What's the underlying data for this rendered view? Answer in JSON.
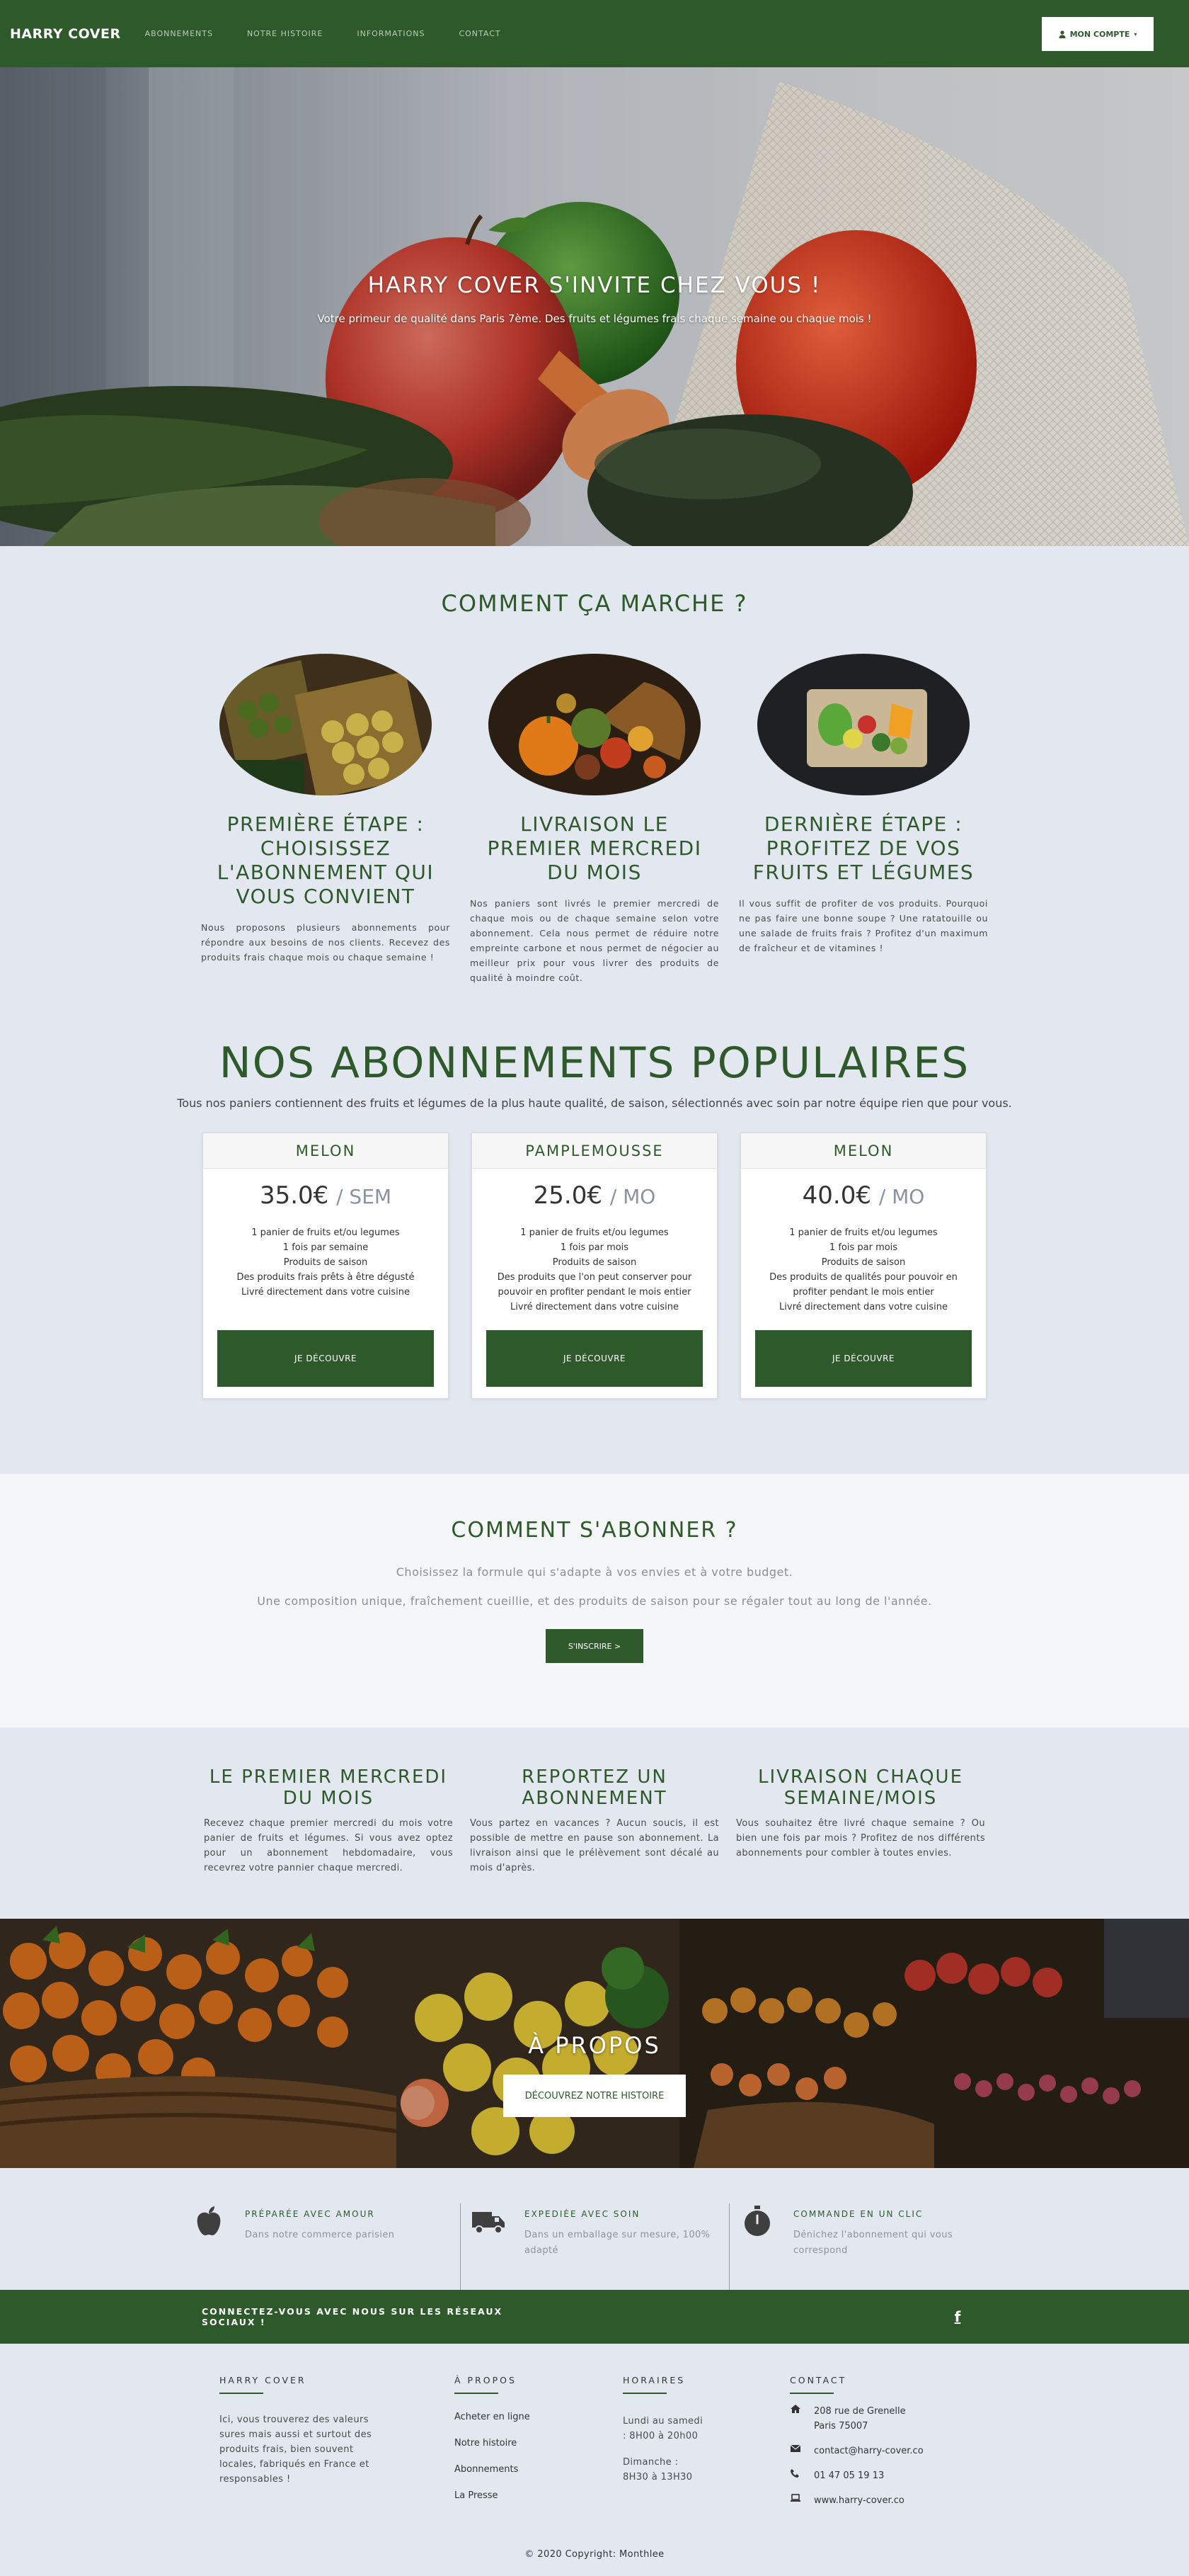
{
  "nav": {
    "brand": "HARRY COVER",
    "links": [
      "ABONNEMENTS",
      "NOTRE HISTOIRE",
      "INFORMATIONS",
      "CONTACT"
    ],
    "account_label": "MON COMPTE"
  },
  "hero": {
    "title": "HARRY COVER S'INVITE CHEZ VOUS !",
    "subtitle": "Votre primeur de qualité dans Paris 7ème. Des fruits et légumes frais chaque semaine ou chaque mois !"
  },
  "how": {
    "title": "COMMENT ÇA MARCHE ?",
    "steps": [
      {
        "title": "PREMIÈRE ÉTAPE : CHOISISSEZ L'ABONNEMENT QUI VOUS CONVIENT",
        "text": "Nous proposons plusieurs abonnements pour répondre aux besoins de nos clients. Recevez des produits frais chaque mois ou chaque semaine !"
      },
      {
        "title": "LIVRAISON LE PREMIER MERCREDI DU MOIS",
        "text": "Nos paniers sont livrés le premier mercredi de chaque mois ou de chaque semaine selon votre abonnement. Cela nous permet de réduire notre empreinte carbone et nous permet de négocier au meilleur prix pour vous livrer des produits de qualité à moindre coût."
      },
      {
        "title": "DERNIÈRE ÉTAPE : PROFITEZ DE VOS FRUITS ET LÉGUMES",
        "text": "Il vous suffit de profiter de vos produits. Pourquoi ne pas faire une bonne soupe ? Une ratatouille ou une salade de fruits frais ? Profitez d'un maximum de fraîcheur et de vitamines !"
      }
    ]
  },
  "popular": {
    "title": "NOS ABONNEMENTS POPULAIRES",
    "subtitle": "Tous nos paniers contiennent des fruits et légumes de la plus haute qualité, de saison, sélectionnés avec soin par notre équipe rien que pour vous.",
    "plans": [
      {
        "name": "MELON",
        "price": "35.0€",
        "period": "/ SEM",
        "features": [
          "1 panier de fruits et/ou legumes",
          "1 fois par semaine",
          "Produits de saison",
          "Des produits frais prêts à être dégusté",
          "Livré directement dans votre cuisine"
        ],
        "button": "JE DÉCOUVRE"
      },
      {
        "name": "PAMPLEMOUSSE",
        "price": "25.0€",
        "period": "/ MO",
        "features": [
          "1 panier de fruits et/ou legumes",
          "1 fois par mois",
          "Produits de saison",
          "Des produits que l'on peut conserver pour",
          "pouvoir en profiter pendant le mois entier",
          "Livré directement dans votre cuisine"
        ],
        "button": "JE DÉCOUVRE"
      },
      {
        "name": "MELON",
        "price": "40.0€",
        "period": "/ MO",
        "features": [
          "1 panier de fruits et/ou legumes",
          "1 fois par mois",
          "Produits de saison",
          "Des produits de qualités pour pouvoir en",
          "profiter pendant le mois entier",
          "Livré directement dans votre cuisine"
        ],
        "button": "JE DÉCOUVRE"
      }
    ]
  },
  "subscribe": {
    "title": "COMMENT S'ABONNER ?",
    "line1": "Choisissez la formule qui s'adapte à vos envies et à votre budget.",
    "line2": "Une composition unique, fraîchement cueillie, et des produits de saison pour se régaler tout au long de l'année.",
    "button": "S'INSCRIRE >"
  },
  "features": [
    {
      "title": "LE PREMIER MERCREDI DU MOIS",
      "text": "Recevez chaque premier mercredi du mois votre panier de fruits et légumes. Si vous avez optez pour un abonnement hebdomadaire, vous recevrez votre pannier chaque mercredi."
    },
    {
      "title": "REPORTEZ UN ABONNEMENT",
      "text": "Vous partez en vacances ? Aucun soucis, il est possible de mettre en pause son abonnement. La livraison ainsi que le prélèvement sont décalé au mois d'après."
    },
    {
      "title": "LIVRAISON CHAQUE SEMAINE/MOIS",
      "text": "Vous souhaitez être livré chaque semaine ? Ou bien une fois par mois ? Profitez de nos différents abonnements pour combler à toutes envies."
    }
  ],
  "about": {
    "title": "À PROPOS",
    "button": "DÉCOUVREZ NOTRE HISTOIRE"
  },
  "perks": [
    {
      "icon": "apple-icon",
      "title": "PRÉPARÉE AVEC AMOUR",
      "text": "Dans notre commerce parisien"
    },
    {
      "icon": "truck-icon",
      "title": "EXPEDIÉE AVEC SOIN",
      "text": "Dans un emballage sur mesure, 100% adapté"
    },
    {
      "icon": "stopwatch-icon",
      "title": "COMMANDE EN UN CLIC",
      "text": "Dénichez l'abonnement qui vous correspond"
    }
  ],
  "social": {
    "text": "CONNECTEZ-VOUS AVEC NOUS SUR LES RÉSEAUX SOCIAUX !",
    "icon": "facebook-icon"
  },
  "footer": {
    "brand_title": "HARRY COVER",
    "brand_text": "Ici, vous trouverez des valeurs sures mais aussi et surtout des produits frais, bien souvent locales, fabriqués en France et responsables !",
    "about_title": "À PROPOS",
    "about_links": [
      "Acheter en ligne",
      "Notre histoire",
      "Abonnements",
      "La Presse"
    ],
    "hours_title": "HORAIRES",
    "hours_saturday": "Lundi au samedi : 8H00 à 20h00",
    "hours_sunday": "Dimanche : 8H30 à 13H30",
    "contact_title": "CONTACT",
    "address": "208 rue de Grenelle Paris 75007",
    "email": "contact@harry-cover.co",
    "phone": "01 47 05 19 13",
    "website": "www.harry-cover.co",
    "copyright": "© 2020 Copyright: Monthlee"
  }
}
